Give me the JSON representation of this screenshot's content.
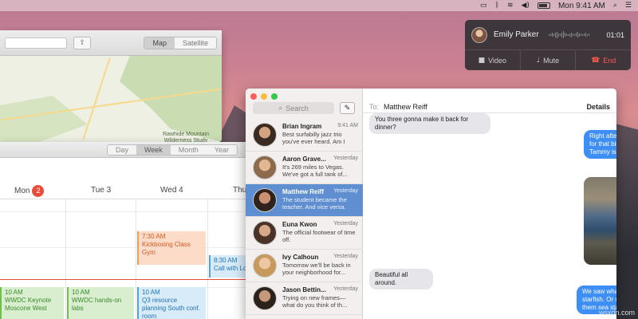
{
  "menubar": {
    "clock": "Mon 9:41 AM"
  },
  "call": {
    "name": "Emily Parker",
    "time": "01:01",
    "video": "Video",
    "mute": "Mute",
    "end": "End",
    "end_color": "#ff5b4e"
  },
  "maps": {
    "map_tab": "Map",
    "satellite_tab": "Satellite",
    "park_label": "Rawhide Mountain Wilderness Study Area"
  },
  "calendar": {
    "views": [
      "Day",
      "Week",
      "Month",
      "Year"
    ],
    "active_view": "Week",
    "days": [
      {
        "label": "Mon"
      },
      {
        "label": "Tue 3"
      },
      {
        "label": "Wed 4"
      },
      {
        "label": "Thu"
      }
    ],
    "today_badge": "2",
    "events": [
      {
        "time": "7:30 AM",
        "title": "Kickboxing Class Gym"
      },
      {
        "time": "8:30 AM",
        "title": "Call with Lo"
      },
      {
        "time": "10 AM",
        "title": "WWDC Keynote Moscone West"
      },
      {
        "time": "10 AM",
        "title": "WWDC hands-on labs"
      },
      {
        "time": "10 AM",
        "title": "Q3 resource planning South conf. room"
      }
    ],
    "now_color": "#e74c3c"
  },
  "messages": {
    "search_placeholder": "Search",
    "to_label": "To:",
    "recipient": "Matthew Reiff",
    "details": "Details",
    "selected_color": "#5f8fd0",
    "conversations": [
      {
        "name": "Brian Ingram",
        "time": "9:41 AM",
        "preview": "Best surfabilly jazz trio you've ever heard. Am I right?"
      },
      {
        "name": "Aaron Grave...",
        "time": "Yesterday",
        "preview": "It's 269 miles to Vegas. We've got a full tank of..."
      },
      {
        "name": "Matthew Reiff",
        "time": "Yesterday",
        "preview": "The student became the teacher. And vice versa."
      },
      {
        "name": "Euna Kwon",
        "time": "Yesterday",
        "preview": "The official footwear of time off."
      },
      {
        "name": "Ivy Calhoun",
        "time": "Yesterday",
        "preview": "Tomorrow we'll be back in your neighborhood for..."
      },
      {
        "name": "Jason Bettin...",
        "time": "Yesterday",
        "preview": "Trying on new frames— what do you think of th..."
      }
    ],
    "chat": [
      {
        "dir": "in",
        "text": "You three gonna make it back for dinner?"
      },
      {
        "dir": "out",
        "text": "Right after dark. Still out on the coast, waiting for that big fat orange sunset. Looks like Tammy is enjoying herself."
      },
      {
        "dir": "in",
        "text": "Beautiful all around."
      },
      {
        "dir": "out",
        "text": "We saw whale spouts, a California condor, and a starfish. Or so I was corrected - now they call them sea stars."
      }
    ],
    "bubble_out_color": "#3d8ef7"
  },
  "watermark": "wsxdn.com"
}
